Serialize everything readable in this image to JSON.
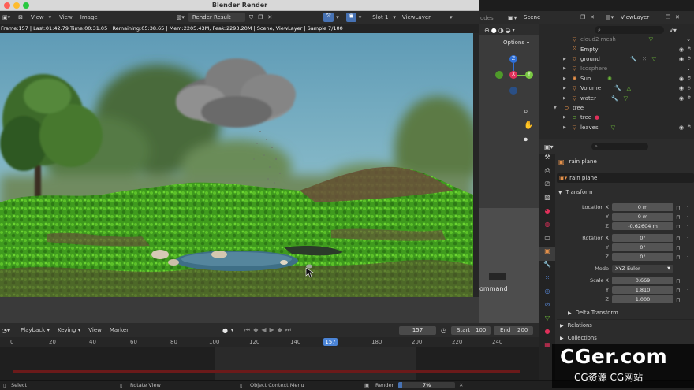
{
  "window": {
    "title": "Blender Render"
  },
  "render_header": {
    "menus": [
      "View",
      "View",
      "Image"
    ],
    "image_name": "Render Result",
    "slot": "Slot 1",
    "view_layer": "ViewLayer"
  },
  "status_line": "Frame:157 | Last:01:42.79 Time:00:31.05 | Remaining:05:38.65 | Mem:2205.43M, Peak:2293.20M | Scene, ViewLayer | Sample 7/100",
  "viewport": {
    "options_label": "Options",
    "workspace_partial": "odes",
    "command_label": "ommand"
  },
  "top_bar": {
    "scene": "Scene",
    "view_layer": "ViewLayer"
  },
  "outliner": {
    "items": [
      {
        "label": "cloud2 mesh",
        "dim": true,
        "icon": "mesh-icon",
        "depth": 1
      },
      {
        "label": "Empty",
        "dim": false,
        "icon": "empty-icon",
        "depth": 1
      },
      {
        "label": "ground",
        "dim": false,
        "icon": "mesh-icon",
        "depth": 1
      },
      {
        "label": "Icosphere",
        "dim": true,
        "icon": "mesh-icon",
        "depth": 1
      },
      {
        "label": "Sun",
        "dim": false,
        "icon": "light-icon",
        "depth": 1
      },
      {
        "label": "Volume",
        "dim": false,
        "icon": "mesh-icon",
        "depth": 1
      },
      {
        "label": "water",
        "dim": false,
        "icon": "mesh-icon",
        "depth": 1
      },
      {
        "label": "tree",
        "dim": false,
        "icon": "collection-icon",
        "depth": 0
      },
      {
        "label": "tree",
        "dim": false,
        "icon": "curve-icon",
        "depth": 1
      },
      {
        "label": "leaves",
        "dim": false,
        "icon": "mesh-icon",
        "depth": 1
      }
    ]
  },
  "properties": {
    "object_name": "rain plane",
    "data_name": "rain plane",
    "transform_label": "Transform",
    "location": {
      "label": "Location X",
      "x": "0 m",
      "y": "0 m",
      "z": "-0.62604 m"
    },
    "rotation": {
      "label": "Rotation X",
      "x": "0°",
      "y": "0°",
      "z": "0°"
    },
    "mode": {
      "label": "Mode",
      "value": "XYZ Euler"
    },
    "scale": {
      "label": "Scale X",
      "x": "0.669",
      "y": "1.810",
      "z": "1.000"
    },
    "axis_y": "Y",
    "axis_z": "Z",
    "sections": [
      "Delta Transform",
      "Relations",
      "Collections"
    ]
  },
  "timeline": {
    "menus": [
      "Playback",
      "Keying",
      "View",
      "Marker"
    ],
    "current_frame": "157",
    "start_label": "Start",
    "start": "100",
    "end_label": "End",
    "end": "200",
    "ticks": [
      "0",
      "20",
      "40",
      "60",
      "80",
      "100",
      "120",
      "140",
      "157",
      "180",
      "200",
      "220",
      "240"
    ]
  },
  "statusbar": {
    "select": "Select",
    "rotate": "Rotate View",
    "context": "Object Context Menu",
    "render_label": "Render",
    "render_progress": "7%",
    "render_fraction": 0.07
  },
  "watermark": {
    "big": "CGer.com",
    "small": "CG资源 CG网站"
  },
  "colors": {
    "accent_blue": "#4772b3",
    "playhead": "#4b84d6",
    "range_red": "#6b1a1a"
  }
}
